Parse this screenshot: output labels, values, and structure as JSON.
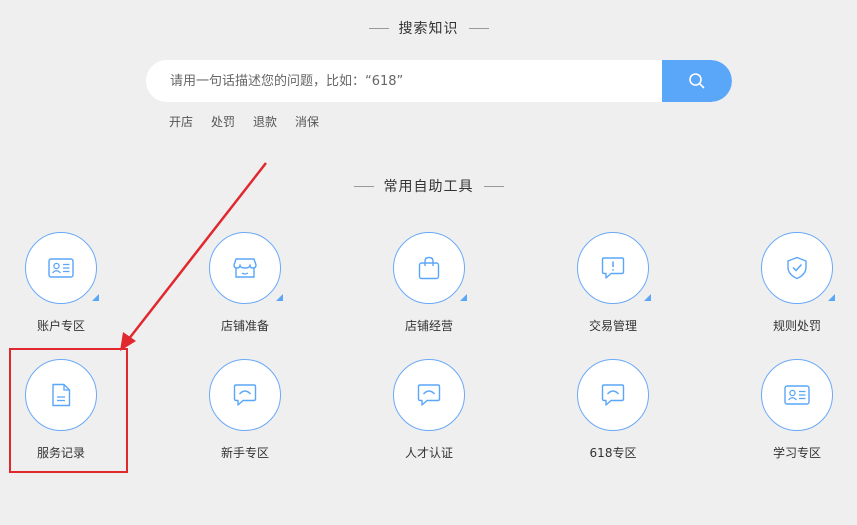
{
  "search_section": {
    "title": "搜索知识"
  },
  "search": {
    "placeholder": "请用一句话描述您的问题，比如：“618”",
    "button_icon": "search-icon"
  },
  "hot_tags": [
    "开店",
    "处罚",
    "退款",
    "消保"
  ],
  "tools_section": {
    "title": "常用自助工具"
  },
  "tools_row1": [
    {
      "label": "账户专区",
      "icon": "id-card-icon"
    },
    {
      "label": "店铺准备",
      "icon": "store-icon"
    },
    {
      "label": "店铺经营",
      "icon": "shopping-bag-icon"
    },
    {
      "label": "交易管理",
      "icon": "alert-message-icon"
    },
    {
      "label": "规则处罚",
      "icon": "shield-check-icon"
    }
  ],
  "tools_row2": [
    {
      "label": "服务记录",
      "icon": "document-icon"
    },
    {
      "label": "新手专区",
      "icon": "chat-bubble-icon"
    },
    {
      "label": "人才认证",
      "icon": "chat-bubble-icon"
    },
    {
      "label": "618专区",
      "icon": "chat-bubble-icon"
    },
    {
      "label": "学习专区",
      "icon": "id-card-icon"
    }
  ],
  "colors": {
    "accent": "#5aa6f9",
    "annotation": "#e0282e",
    "background": "#efefef"
  }
}
